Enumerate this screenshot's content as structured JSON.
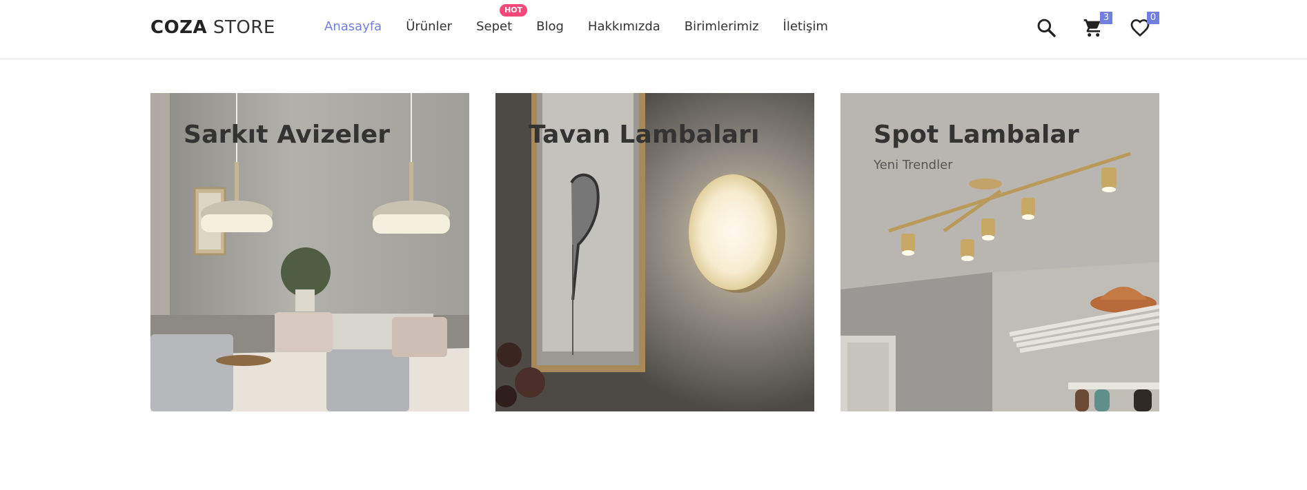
{
  "header": {
    "logo": {
      "bold": "COZA",
      "light": " STORE"
    },
    "nav": [
      {
        "label": "Anasayfa",
        "active": true
      },
      {
        "label": "Ürünler"
      },
      {
        "label": "Sepet",
        "badge": "HOT"
      },
      {
        "label": "Blog"
      },
      {
        "label": "Hakkımızda"
      },
      {
        "label": "Birimlerimiz"
      },
      {
        "label": "İletişim"
      }
    ],
    "icons": {
      "search": "search-icon",
      "cart": "cart-icon",
      "cart_count": "3",
      "wishlist": "heart-icon",
      "wishlist_count": "0"
    }
  },
  "banners": [
    {
      "title": "Sarkıt Avizeler",
      "subtitle": ""
    },
    {
      "title": "Tavan Lambaları",
      "subtitle": ""
    },
    {
      "title": "Spot Lambalar",
      "subtitle": "Yeni Trendler"
    }
  ],
  "colors": {
    "accent": "#717fe0",
    "hot": "#f74877",
    "text": "#333333"
  }
}
